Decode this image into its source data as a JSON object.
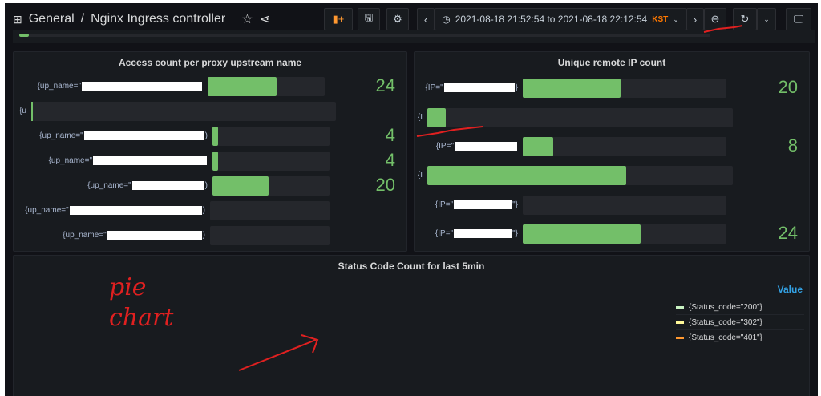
{
  "header": {
    "folder": "General",
    "separator": "/",
    "dashboard": "Nginx Ingress controller",
    "time_range": "2021-08-18 21:52:54 to 2021-08-18 22:12:54",
    "timezone": "KST"
  },
  "panels": {
    "access": {
      "title": "Access count per proxy upstream name",
      "rows": [
        {
          "label": "{up_name=\"",
          "suffix": "",
          "fill": 0.59,
          "value": "24"
        },
        {
          "label": "{u",
          "suffix": "",
          "fill": 0.005,
          "value": ""
        },
        {
          "label": "{up_name=\"",
          "suffix": ")",
          "fill": 0.05,
          "value": "4"
        },
        {
          "label": "{up_name=\"",
          "suffix": "",
          "fill": 0.05,
          "value": "4"
        },
        {
          "label": "{up_name=\"",
          "suffix": ")",
          "fill": 0.48,
          "value": "20"
        },
        {
          "label": "{up_name=\"",
          "suffix": ")",
          "fill": 0,
          "value": ""
        },
        {
          "label": "{up_name=\"",
          "suffix": ")",
          "fill": 0,
          "value": ""
        }
      ]
    },
    "ip": {
      "title": "Unique remote IP count",
      "rows": [
        {
          "label": "{IP=\"",
          "suffix": "}",
          "fill": 0.48,
          "value": "20"
        },
        {
          "label": "{I",
          "suffix": "",
          "fill": 0.06,
          "value": ""
        },
        {
          "label": "{IP=\"",
          "suffix": "",
          "fill": 0.15,
          "value": "8"
        },
        {
          "label": "{I",
          "suffix": "",
          "fill": 0.65,
          "value": ""
        },
        {
          "label": "{IP=\"",
          "suffix": "\"}",
          "fill": 0,
          "value": ""
        },
        {
          "label": "{IP=\"",
          "suffix": "\"}",
          "fill": 0.58,
          "value": "24"
        }
      ]
    },
    "status": {
      "title": "Status Code Count for last 5min",
      "legend_header": "Value",
      "legend": [
        {
          "label": "{Status_code=\"200\"}",
          "color": "#c8f2c2"
        },
        {
          "label": "{Status_code=\"302\"}",
          "color": "#fff899"
        },
        {
          "label": "{Status_code=\"401\"}",
          "color": "#ff9830"
        }
      ]
    }
  },
  "annotation": {
    "text_line1": "pie",
    "text_line2": "chart",
    "color": "#e02020"
  }
}
